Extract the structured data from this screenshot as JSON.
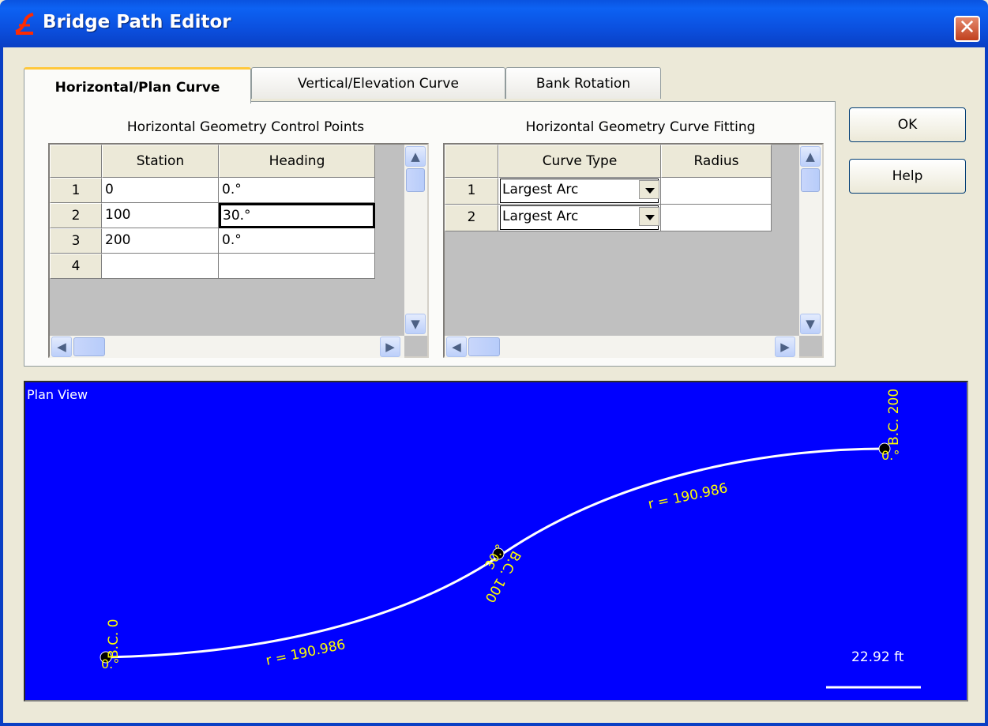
{
  "window": {
    "title": "Bridge Path Editor",
    "close_glyph": "✕"
  },
  "tabs": [
    {
      "label": "Horizontal/Plan Curve",
      "active": true
    },
    {
      "label": "Vertical/Elevation Curve",
      "active": false
    },
    {
      "label": "Bank Rotation",
      "active": false
    }
  ],
  "control_points": {
    "title": "Horizontal Geometry Control Points",
    "headers": [
      "Station",
      "Heading"
    ],
    "rows": [
      {
        "num": "1",
        "station": "0",
        "heading": "0.°"
      },
      {
        "num": "2",
        "station": "100",
        "heading": "30.°"
      },
      {
        "num": "3",
        "station": "200",
        "heading": "0.°"
      },
      {
        "num": "4",
        "station": "",
        "heading": ""
      }
    ]
  },
  "curve_fitting": {
    "title": "Horizontal Geometry Curve Fitting",
    "headers": [
      "Curve Type",
      "Radius"
    ],
    "rows": [
      {
        "num": "1",
        "curve_type": "Largest Arc",
        "radius": ""
      },
      {
        "num": "2",
        "curve_type": "Largest Arc",
        "radius": ""
      }
    ]
  },
  "buttons": {
    "ok": "OK",
    "help": "Help"
  },
  "scroll": {
    "up": "▲",
    "down": "▼",
    "left": "◀",
    "right": "▶"
  },
  "plan_view": {
    "label": "Plan View",
    "background": "#0000ff",
    "path_color": "#ffffff",
    "annotation_color": "#ffff00",
    "points": [
      {
        "name": "B.C. 0",
        "heading": "0.°"
      },
      {
        "name": "B.C. 100",
        "heading": "30.°"
      },
      {
        "name": "B.C. 200",
        "heading": "0.°"
      }
    ],
    "radius_labels": [
      "r = 190.986",
      "r = 190.986"
    ],
    "scale": "22.92 ft"
  }
}
